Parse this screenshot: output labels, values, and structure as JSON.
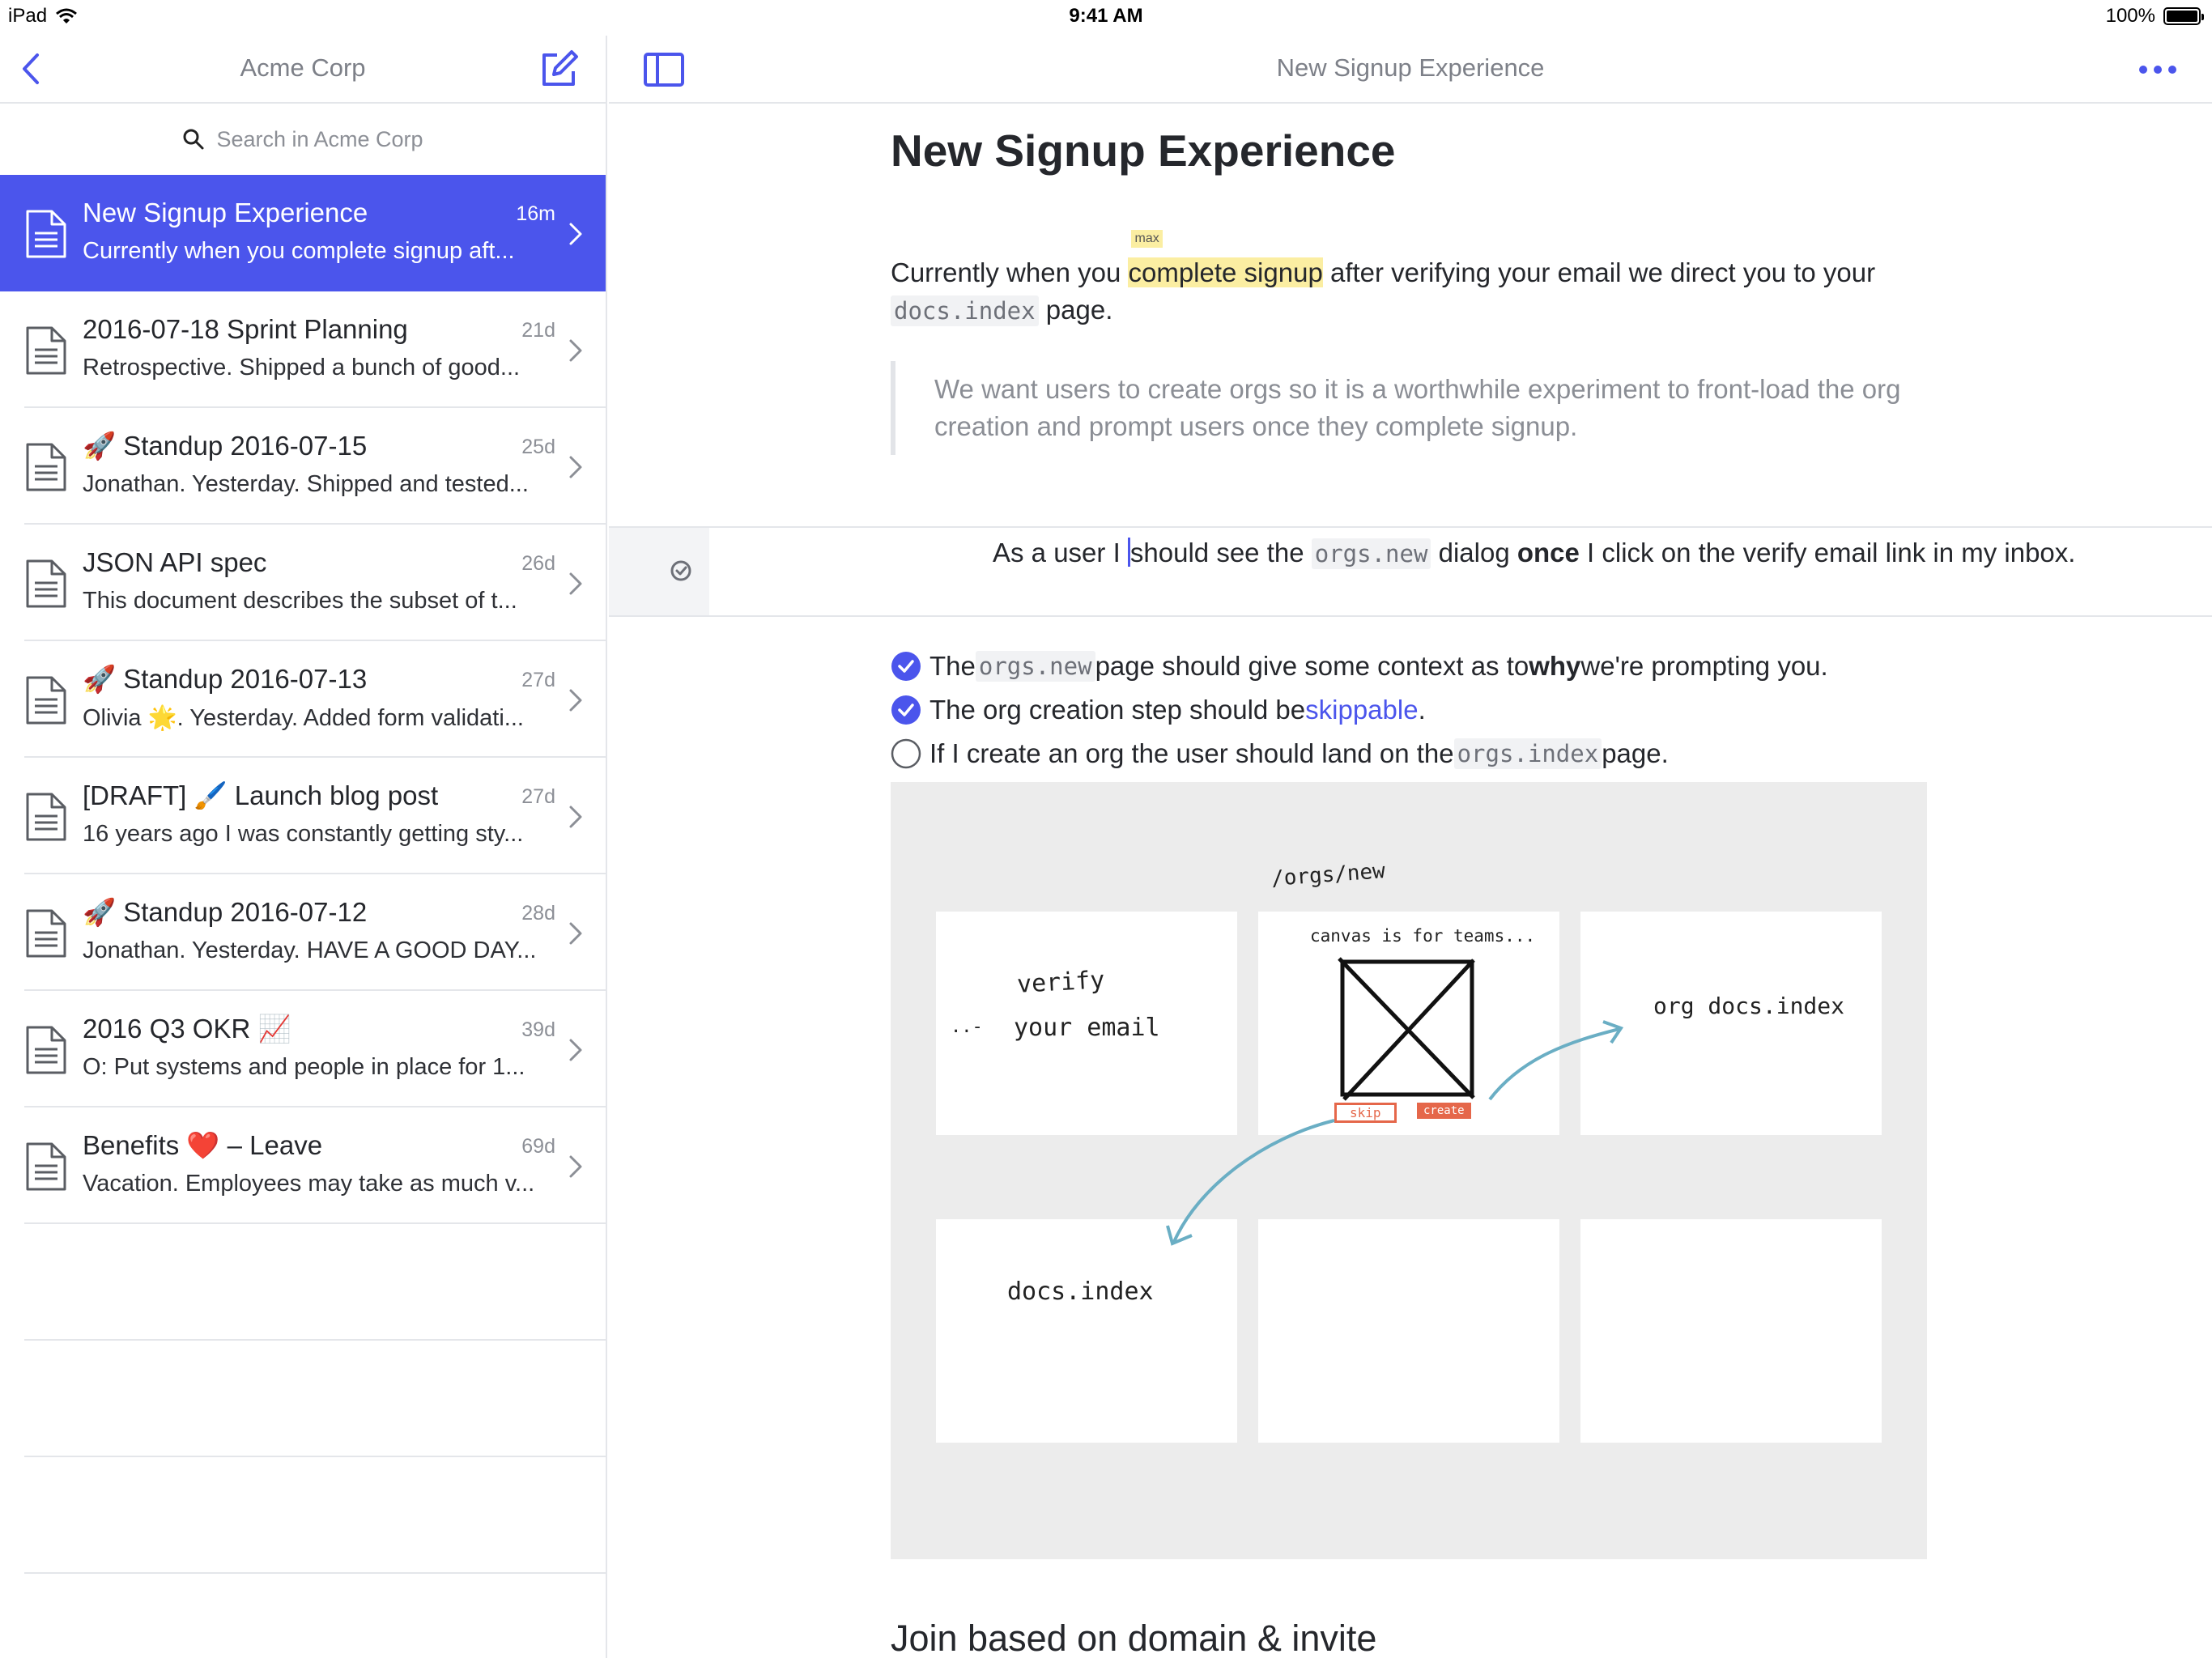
{
  "status_bar": {
    "device": "iPad",
    "time": "9:41 AM",
    "battery": "100%",
    "battery_level": 1.0
  },
  "sidebar": {
    "title": "Acme Corp",
    "search_placeholder": "Search in Acme Corp",
    "documents": [
      {
        "title": "New Signup Experience",
        "age": "16m",
        "snippet": "Currently when you complete signup aft...",
        "active": true
      },
      {
        "title": "2016-07-18 Sprint Planning",
        "age": "21d",
        "snippet": "Retrospective. Shipped a bunch of good..."
      },
      {
        "title": "🚀 Standup 2016-07-15",
        "age": "25d",
        "snippet": "Jonathan. Yesterday. Shipped and tested..."
      },
      {
        "title": "JSON API spec",
        "age": "26d",
        "snippet": "This document describes the subset of t..."
      },
      {
        "title": "🚀 Standup 2016-07-13",
        "age": "27d",
        "snippet": "Olivia 🌟. Yesterday. Added form validati..."
      },
      {
        "title": "[DRAFT] 🖌️ Launch blog post",
        "age": "27d",
        "snippet": "16 years ago I was constantly getting sty..."
      },
      {
        "title": "🚀 Standup 2016-07-12",
        "age": "28d",
        "snippet": "Jonathan. Yesterday. HAVE A GOOD DAY..."
      },
      {
        "title": "2016 Q3 OKR 📈",
        "age": "39d",
        "snippet": "O: Put systems and people in place for 1..."
      },
      {
        "title": "Benefits ❤️ – Leave",
        "age": "69d",
        "snippet": "Vacation. Employees may take as much v..."
      }
    ]
  },
  "document": {
    "header_title": "New Signup Experience",
    "title": "New Signup Experience",
    "para": {
      "before": "Currently when you ",
      "highlight": "complete signup",
      "highlight_tag": "max",
      "middle": " after verifying your email we direct you to your ",
      "code": "docs.index",
      "after": " page."
    },
    "quote": "We want users to create orgs so it is a worthwhile experiment to front-load the org creation and prompt users once they complete signup.",
    "story": {
      "before_caret": "As a user I ",
      "after_caret": "should see the ",
      "code": "orgs.new",
      "middle": " dialog ",
      "bold": "once",
      "after": " I click on the verify email link in my inbox."
    },
    "checklist": [
      {
        "checked": true,
        "pre": "The ",
        "code": "orgs.new",
        "mid": " page should give some context as to ",
        "bold": "why",
        "post": " we're prompting you."
      },
      {
        "checked": true,
        "pre": "The org creation step should be ",
        "link": "skippable",
        "post": "."
      },
      {
        "checked": false,
        "pre": "If I create an org the user should land on the ",
        "code": "orgs.index",
        "post": " page."
      }
    ],
    "sketch": {
      "path_label": "/orgs/new",
      "card1": [
        "verify",
        "your email"
      ],
      "card1_dots": "..-",
      "card2_top": "canvas is for teams...",
      "card2_skip": "skip",
      "card2_create": "create",
      "card3": "org docs.index",
      "card4": "docs.index"
    },
    "next_heading": "Join based on domain & invite"
  },
  "colors": {
    "accent": "#4b55ec",
    "highlight": "#fbeea2",
    "sketch_arrow": "#6aaec4",
    "sketch_red": "#e5674a"
  }
}
